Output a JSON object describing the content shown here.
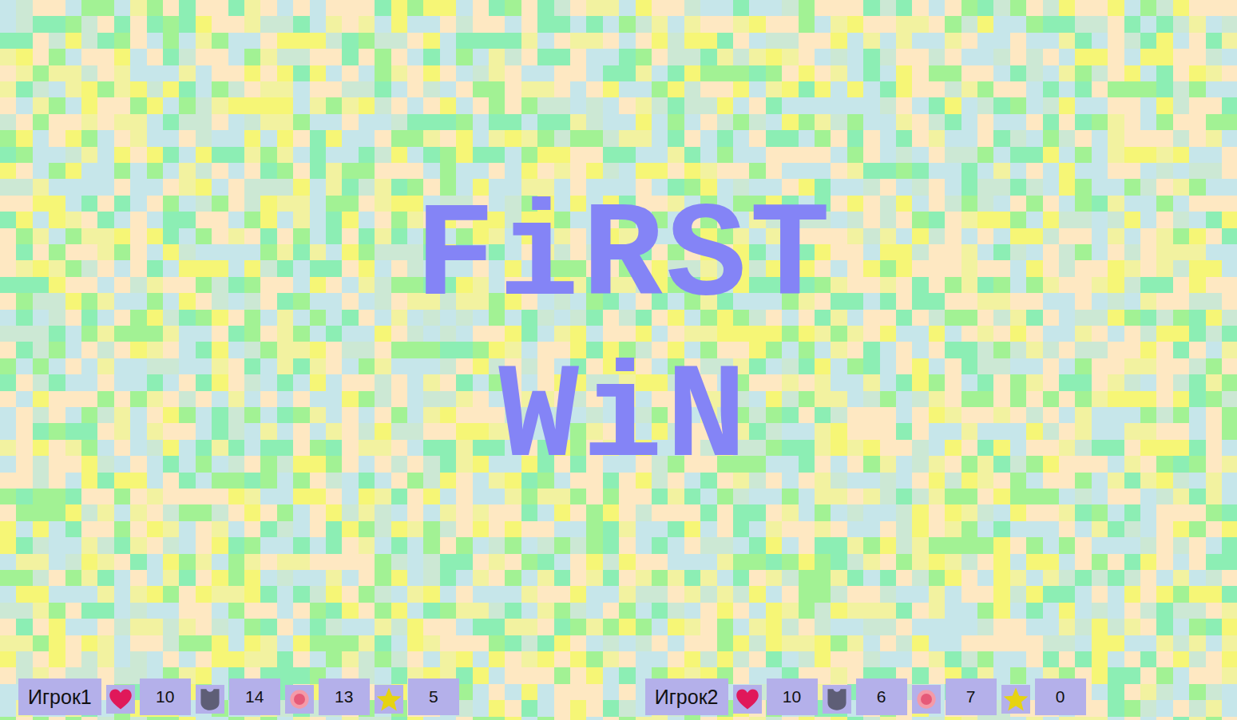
{
  "banner": {
    "lines": [
      "FiRST",
      "WiN"
    ]
  },
  "players": [
    {
      "name": "Игрок1",
      "stats": [
        {
          "kind": "health",
          "value": "10"
        },
        {
          "kind": "armor",
          "value": "14"
        },
        {
          "kind": "mana",
          "value": "13"
        },
        {
          "kind": "star",
          "value": "5"
        }
      ]
    },
    {
      "name": "Игрок2",
      "stats": [
        {
          "kind": "health",
          "value": "10"
        },
        {
          "kind": "armor",
          "value": "6"
        },
        {
          "kind": "mana",
          "value": "7"
        },
        {
          "kind": "star",
          "value": "0"
        }
      ]
    }
  ]
}
